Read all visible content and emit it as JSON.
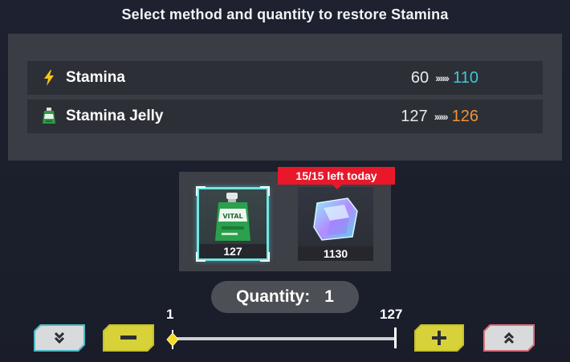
{
  "title": "Select method and quantity to restore Stamina",
  "rows": [
    {
      "icon": "lightning-icon",
      "label": "Stamina",
      "old": "60",
      "arrows": "››››››",
      "new": "110",
      "new_color": "#3ec7d6"
    },
    {
      "icon": "stamina-jelly-icon",
      "label": "Stamina Jelly",
      "old": "127",
      "arrows": "››››››",
      "new": "126",
      "new_color": "#f2923a"
    }
  ],
  "items": [
    {
      "name": "stamina-jelly-item",
      "count": "127",
      "selected": true
    },
    {
      "name": "crystal-item",
      "count": "1130",
      "selected": false
    }
  ],
  "badge": "15/15 left today",
  "quantity": {
    "label": "Quantity:",
    "value": "1"
  },
  "slider": {
    "min_label": "1",
    "max_label": "127",
    "value": 1,
    "min": 1,
    "max": 127
  },
  "buttons": {
    "min": "double-chevron-down-icon",
    "decrement": "minus-icon",
    "increment": "plus-icon",
    "max": "double-chevron-up-icon"
  },
  "colors": {
    "accent_cyan": "#3ec7d6",
    "accent_orange": "#f2923a",
    "badge_red": "#e8182a",
    "button_yellow": "#d8d23a"
  }
}
